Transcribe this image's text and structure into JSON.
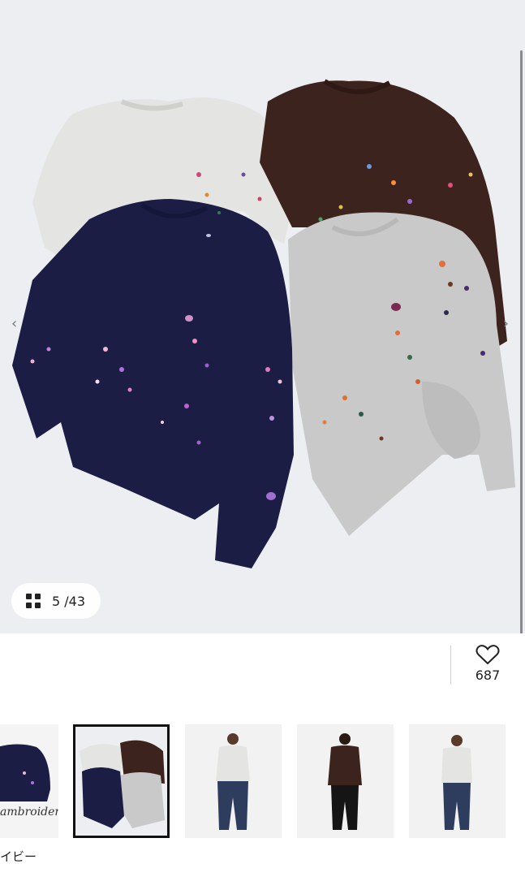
{
  "gallery": {
    "current": "5",
    "total": "/43",
    "prev_arrow": "‹",
    "next_arrow": "›"
  },
  "favorite": {
    "count": "687"
  },
  "thumbnails": [
    {
      "caption": "ambroidery",
      "selected": false
    },
    {
      "selected": true
    },
    {
      "selected": false
    },
    {
      "selected": false
    },
    {
      "selected": false
    }
  ],
  "variant_label": "イビー",
  "colors": {
    "navy": "#1b1d44",
    "brown": "#3d231d",
    "heather_gray": "#c9c9c9",
    "light_gray": "#e4e4e2",
    "background": "#eceef1"
  }
}
